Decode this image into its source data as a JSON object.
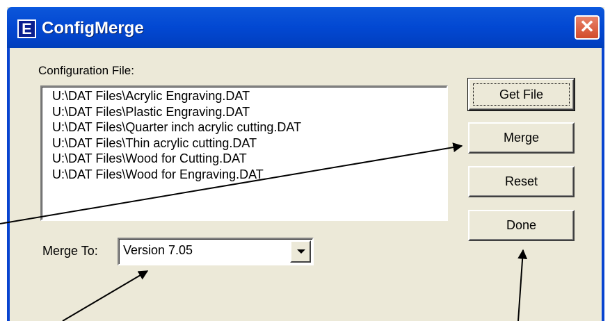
{
  "window": {
    "title": "ConfigMerge",
    "app_icon_letter": "E",
    "close_glyph": "✕"
  },
  "config_file": {
    "label": "Configuration File:",
    "files": [
      "U:\\DAT Files\\Acrylic Engraving.DAT",
      "U:\\DAT Files\\Plastic Engraving.DAT",
      "U:\\DAT Files\\Quarter inch acrylic cutting.DAT",
      "U:\\DAT Files\\Thin acrylic cutting.DAT",
      "U:\\DAT Files\\Wood for Cutting.DAT",
      "U:\\DAT Files\\Wood for Engraving.DAT"
    ]
  },
  "buttons": {
    "get_file": "Get File",
    "merge": "Merge",
    "reset": "Reset",
    "done": "Done"
  },
  "merge_to": {
    "label": "Merge To:",
    "selected": "Version 7.05"
  },
  "icons": {
    "app": "app-e-icon",
    "close": "close-icon",
    "dropdown": "chevron-down-icon"
  },
  "colors": {
    "titlebar": "#0248d2",
    "dialog_bg": "#ece9d8",
    "close_button": "#d24b2b"
  }
}
